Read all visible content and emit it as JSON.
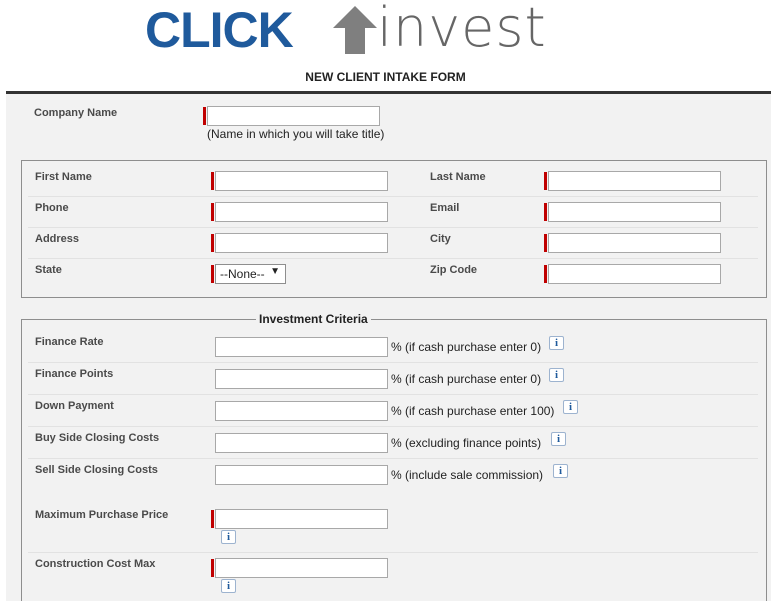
{
  "brand": {
    "click": "CLICK",
    "invest": "invest",
    "primary_color": "#1f5a9c",
    "secondary_color": "#666666"
  },
  "form": {
    "title": "NEW CLIENT INTAKE FORM"
  },
  "company": {
    "label": "Company Name",
    "value": "",
    "hint": "(Name in which you will take title)"
  },
  "contact": {
    "first_name_label": "First Name",
    "last_name_label": "Last Name",
    "phone_label": "Phone",
    "email_label": "Email",
    "address_label": "Address",
    "city_label": "City",
    "state_label": "State",
    "state_value": "--None--",
    "zip_label": "Zip Code"
  },
  "criteria": {
    "legend": "Investment Criteria",
    "finance_rate_label": "Finance Rate",
    "finance_rate_hint": "% (if cash purchase enter 0)",
    "finance_points_label": "Finance Points",
    "finance_points_hint": "% (if cash purchase enter 0)",
    "down_payment_label": "Down Payment",
    "down_payment_hint": "% (if cash purchase enter 100)",
    "buy_closing_label": "Buy Side Closing Costs",
    "buy_closing_hint": "% (excluding finance points)",
    "sell_closing_label": "Sell Side Closing Costs",
    "sell_closing_hint": "% (include sale commission)",
    "max_price_label": "Maximum Purchase Price",
    "construction_label": "Construction Cost Max"
  },
  "icons": {
    "info_glyph": "i",
    "select_caret": "▼",
    "required_color": "#c00000"
  }
}
